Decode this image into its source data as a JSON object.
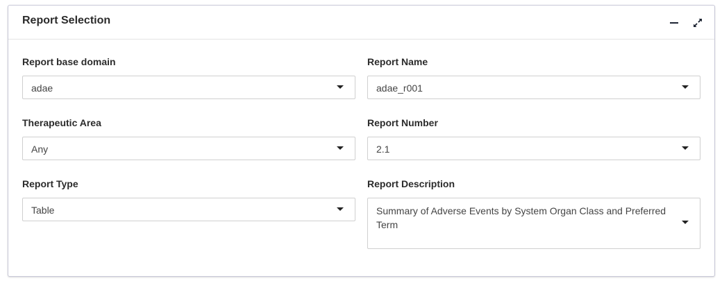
{
  "panel": {
    "title": "Report Selection",
    "minimize_icon": "minus-icon",
    "maximize_icon": "expand-icon"
  },
  "fields": {
    "base_domain": {
      "label": "Report base domain",
      "value": "adae"
    },
    "report_name": {
      "label": "Report Name",
      "value": "adae_r001"
    },
    "therapeutic_area": {
      "label": "Therapeutic Area",
      "value": "Any"
    },
    "report_number": {
      "label": "Report Number",
      "value": "2.1"
    },
    "report_type": {
      "label": "Report Type",
      "value": "Table"
    },
    "report_description": {
      "label": "Report Description",
      "value": "Summary of Adverse Events by System Organ Class and Preferred Term"
    }
  }
}
